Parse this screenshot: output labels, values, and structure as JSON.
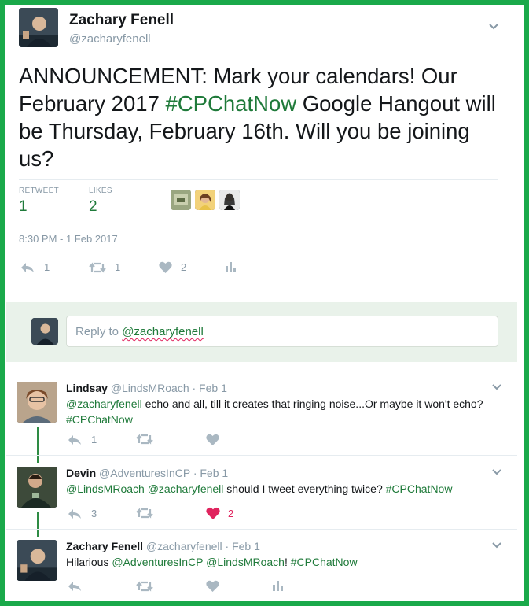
{
  "tweet": {
    "author_name": "Zachary Fenell",
    "author_handle": "@zacharyfenell",
    "text_before": "ANNOUNCEMENT: Mark your calendars! Our February 2017 ",
    "hashtag": "#CPChatNow",
    "text_after": " Google Hangout will be Thursday, February 16th. Will you be joining us?",
    "retweets_label": "RETWEET",
    "retweets_count": "1",
    "likes_label": "LIKES",
    "likes_count": "2",
    "timestamp": "8:30 PM - 1 Feb 2017",
    "actions": {
      "reply_count": "1",
      "retweet_count": "1",
      "like_count": "2"
    }
  },
  "reply_box": {
    "prefix": "Reply to ",
    "mention": "@zacharyfenell"
  },
  "replies": [
    {
      "name": "Lindsay",
      "handle": "@LindsMRoach",
      "date": "· Feb 1",
      "mention1": "@zacharyfenell",
      "text1": " echo and all, till it creates that ringing noise...Or maybe it won't echo? ",
      "hashtag": "#CPChatNow",
      "reply_count": "1"
    },
    {
      "name": "Devin",
      "handle": "@AdventuresInCP",
      "date": "· Feb 1",
      "mention1": "@LindsMRoach",
      "mention2": "@zacharyfenell",
      "text1": " should I tweet everything twice? ",
      "hashtag": "#CPChatNow",
      "reply_count": "3",
      "like_count": "2"
    },
    {
      "name": "Zachary Fenell",
      "handle": "@zacharyfenell",
      "date": "· Feb 1",
      "text0": "Hilarious ",
      "mention1": "@AdventuresInCP",
      "mention2": "@LindsMRoach",
      "text1": "! ",
      "hashtag": "#CPChatNow"
    }
  ],
  "colors": {
    "border": "#1aa94a",
    "accent": "#1f7a3a",
    "muted": "#8899a6",
    "liked": "#e0245e"
  },
  "icons": [
    "chevron-down-icon",
    "reply-icon",
    "retweet-icon",
    "heart-icon",
    "analytics-icon"
  ]
}
